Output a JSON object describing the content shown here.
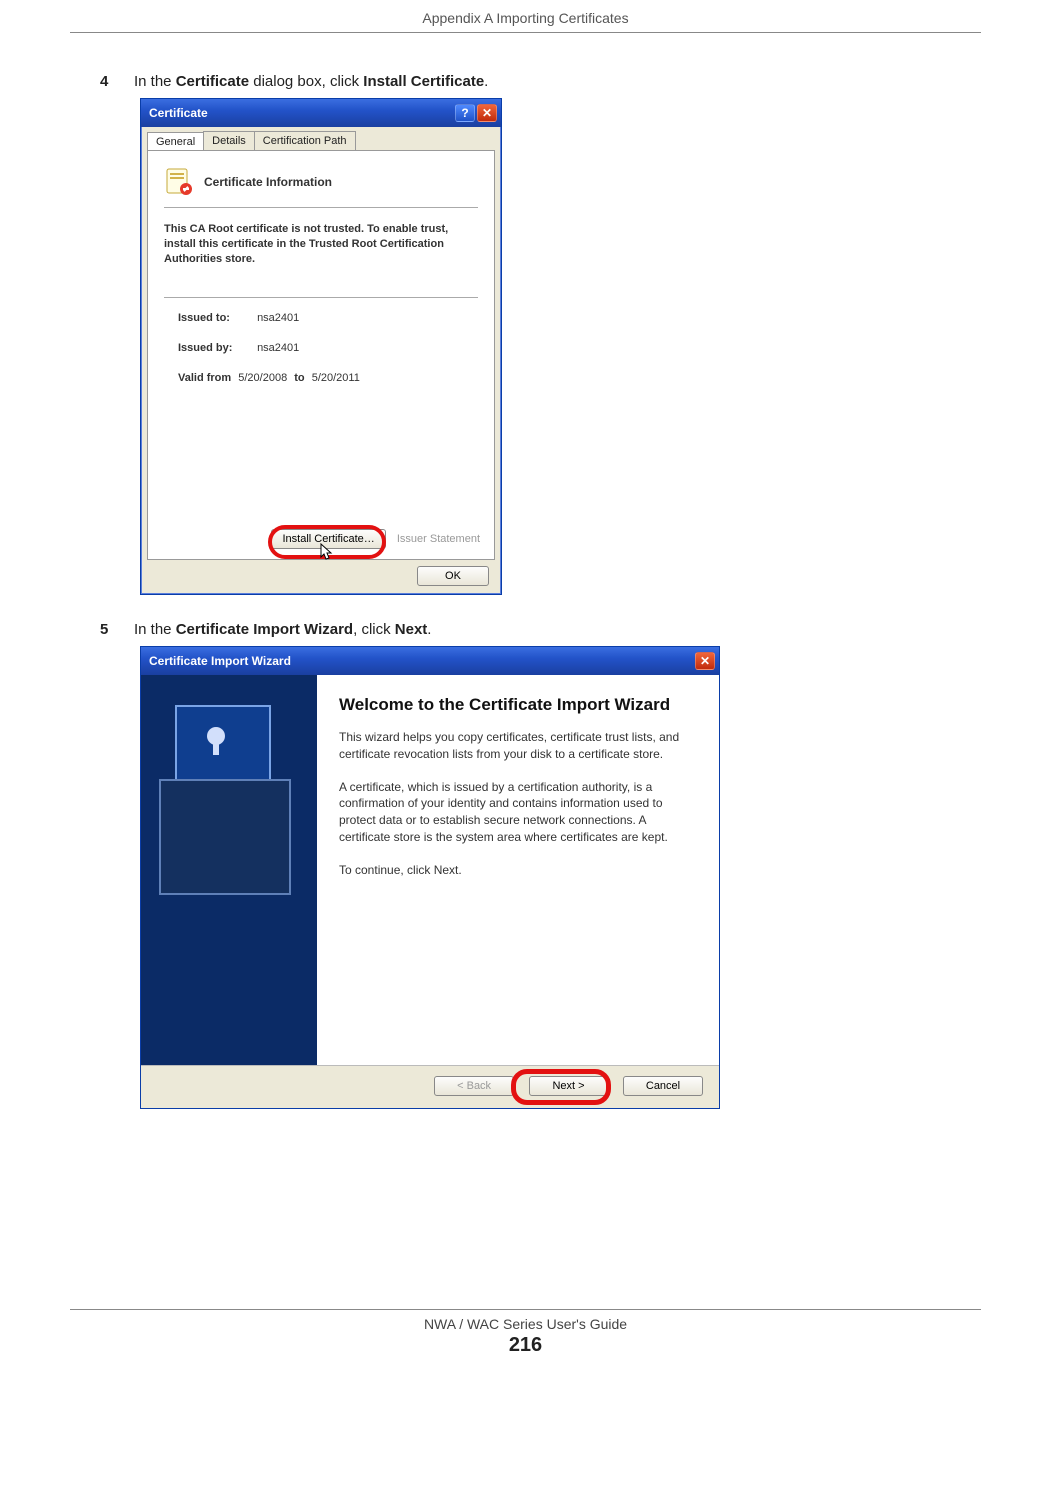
{
  "header": {
    "appendix": "Appendix A Importing Certificates"
  },
  "steps": {
    "s4": {
      "num": "4",
      "pre": "In the ",
      "b1": "Certificate",
      "mid": " dialog box, click ",
      "b2": "Install Certificate",
      "post": "."
    },
    "s5": {
      "num": "5",
      "pre": "In the ",
      "b1": "Certificate Import Wizard",
      "mid": ", click ",
      "b2": "Next",
      "post": "."
    }
  },
  "cert_dialog": {
    "title": "Certificate",
    "help": "?",
    "close": "✕",
    "tabs": {
      "general": "General",
      "details": "Details",
      "path": "Certification Path"
    },
    "info_title": "Certificate Information",
    "warn": "This CA Root certificate is not trusted. To enable trust, install this certificate in the Trusted Root Certification Authorities store.",
    "issued_to_lbl": "Issued to:",
    "issued_to_val": "nsa2401",
    "issued_by_lbl": "Issued by:",
    "issued_by_val": "nsa2401",
    "valid_from_lbl": "Valid from",
    "valid_from_val": "5/20/2008",
    "valid_to_lbl": "to",
    "valid_to_val": "5/20/2011",
    "install_btn": "Install Certificate…",
    "issuer_stmt": "Issuer Statement",
    "ok": "OK"
  },
  "wizard": {
    "title": "Certificate Import Wizard",
    "close": "✕",
    "h1": "Welcome to the Certificate Import Wizard",
    "p1": "This wizard helps you copy certificates, certificate trust lists, and certificate revocation lists from your disk to a certificate store.",
    "p2": "A certificate, which is issued by a certification authority, is a confirmation of your identity and contains information used to protect data or to establish secure network connections. A certificate store is the system area where certificates are kept.",
    "p3": "To continue, click Next.",
    "back": "< Back",
    "next": "Next >",
    "cancel": "Cancel"
  },
  "footer": {
    "guide": "NWA / WAC Series User's Guide",
    "page": "216"
  }
}
